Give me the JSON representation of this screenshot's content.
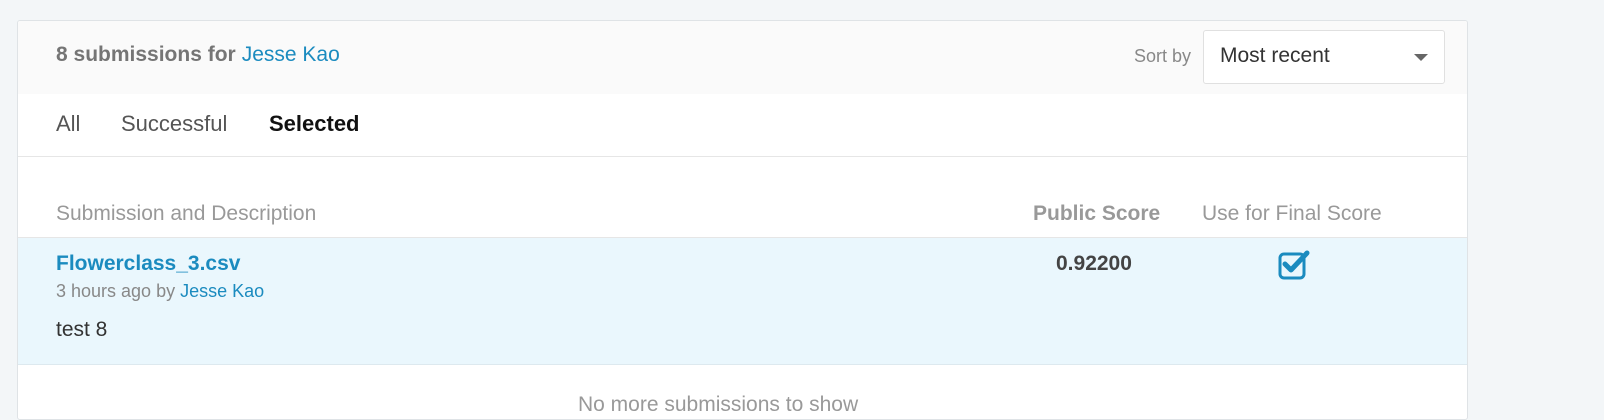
{
  "header": {
    "title_prefix": "8 submissions for",
    "user": "Jesse Kao",
    "sort_label": "Sort by",
    "sort_value": "Most recent"
  },
  "tabs": [
    {
      "label": "All",
      "active": false
    },
    {
      "label": "Successful",
      "active": false
    },
    {
      "label": "Selected",
      "active": true
    }
  ],
  "table": {
    "columns": [
      "Submission and Description",
      "Public Score",
      "Use for Final Score"
    ],
    "rows": [
      {
        "file": "Flowerclass_3.csv",
        "time": "3 hours ago by",
        "author": "Jesse Kao",
        "description": "test 8",
        "public_score": "0.92200",
        "use_for_final": true
      }
    ]
  },
  "footer_text": "No more submissions to show",
  "colors": {
    "accent": "#1b8bbf",
    "row_highlight": "#eaf7fd"
  }
}
